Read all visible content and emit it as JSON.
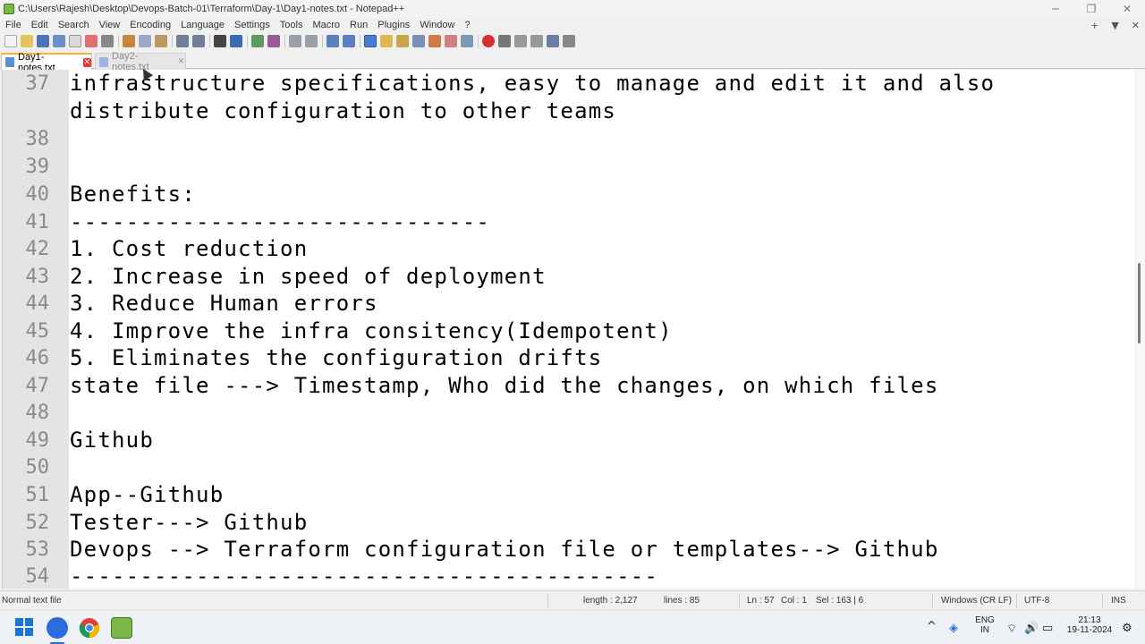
{
  "window": {
    "title": "C:\\Users\\Rajesh\\Desktop\\Devops-Batch-01\\Terraform\\Day-1\\Day1-notes.txt - Notepad++",
    "minimize_glyph": "─",
    "maximize_glyph": "❐",
    "close_glyph": "✕"
  },
  "menu": {
    "items": [
      "File",
      "Edit",
      "Search",
      "View",
      "Encoding",
      "Language",
      "Settings",
      "Tools",
      "Macro",
      "Run",
      "Plugins",
      "Window",
      "?"
    ],
    "right_add": "+",
    "right_dropdown": "▼",
    "right_close": "✕"
  },
  "tabs": [
    {
      "label": "Day1-notes.txt",
      "active": true
    },
    {
      "label": "Day2-notes.txt",
      "active": false
    }
  ],
  "editor": {
    "lines": [
      {
        "num": "37",
        "text": "infrastructure specifications, easy to manage and edit it and also"
      },
      {
        "num": "",
        "text": "distribute configuration to other teams"
      },
      {
        "num": "38",
        "text": ""
      },
      {
        "num": "39",
        "text": ""
      },
      {
        "num": "40",
        "text": "Benefits:"
      },
      {
        "num": "41",
        "text": "------------------------------"
      },
      {
        "num": "42",
        "text": "1. Cost reduction"
      },
      {
        "num": "43",
        "text": "2. Increase in speed of deployment"
      },
      {
        "num": "44",
        "text": "3. Reduce Human errors"
      },
      {
        "num": "45",
        "text": "4. Improve the infra consitency(Idempotent)"
      },
      {
        "num": "46",
        "text": "5. Eliminates the configuration drifts"
      },
      {
        "num": "47",
        "text": "state file ---> Timestamp, Who did the changes, on which files"
      },
      {
        "num": "48",
        "text": ""
      },
      {
        "num": "49",
        "text": "Github"
      },
      {
        "num": "50",
        "text": ""
      },
      {
        "num": "51",
        "text": "App--Github"
      },
      {
        "num": "52",
        "text": "Tester---> Github"
      },
      {
        "num": "53",
        "text": "Devops --> Terraform configuration file or templates--> Github"
      },
      {
        "num": "54",
        "text": "------------------------------------------"
      }
    ]
  },
  "status": {
    "file_type": "Normal text file",
    "length": "length : 2,127",
    "lines": "lines : 85",
    "ln": "Ln : 57",
    "col": "Col : 1",
    "sel": "Sel : 163 | 6",
    "eol": "Windows (CR LF)",
    "encoding": "UTF-8",
    "mode": "INS"
  },
  "taskbar": {
    "lang_top": "ENG",
    "lang_bottom": "IN",
    "time": "21:13",
    "date": "19-11-2024",
    "tray_chevron": "^"
  },
  "colors": {
    "active_tab_accent": "#f7b32b",
    "gutter": "#e4e4e4",
    "editor_bg": "#ffffff"
  }
}
